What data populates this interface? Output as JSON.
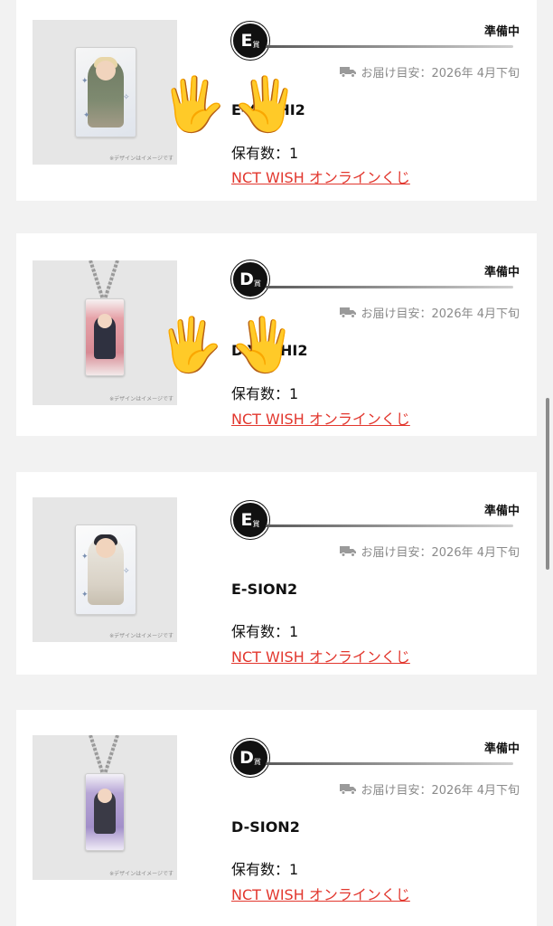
{
  "items": [
    {
      "rank_letter": "E",
      "rank_suffix": "賞",
      "status": "準備中",
      "delivery": "お届け目安：2026年 4月下旬",
      "name": "E-YUSHI2",
      "owned": "保有数：1",
      "link": "NCT WISH オンラインくじ",
      "thumb_note": "※デザインはイメージです",
      "thumb_icon": "acrylic-stand-icon"
    },
    {
      "rank_letter": "D",
      "rank_suffix": "賞",
      "status": "準備中",
      "delivery": "お届け目安：2026年 4月下旬",
      "name": "D-YUSHI2",
      "owned": "保有数：1",
      "link": "NCT WISH オンラインくじ",
      "thumb_note": "※デザインはイメージです",
      "thumb_icon": "keychain-icon"
    },
    {
      "rank_letter": "E",
      "rank_suffix": "賞",
      "status": "準備中",
      "delivery": "お届け目安：2026年 4月下旬",
      "name": "E-SION2",
      "owned": "保有数：1",
      "link": "NCT WISH オンラインくじ",
      "thumb_note": "※デザインはイメージです",
      "thumb_icon": "acrylic-stand-icon"
    },
    {
      "rank_letter": "D",
      "rank_suffix": "賞",
      "status": "準備中",
      "delivery": "お届け目安：2026年 4月下旬",
      "name": "D-SION2",
      "owned": "保有数：1",
      "link": "NCT WISH オンラインくじ",
      "thumb_note": "※デザインはイメージです",
      "thumb_icon": "keychain-icon"
    }
  ],
  "overlay": {
    "hand_emoji": "🖐",
    "hand_icon": "raised-hand-emoji-icon"
  },
  "colors": {
    "link": "#e2372e",
    "page_bg": "#f2f2f2",
    "card_bg": "#ffffff",
    "rank_badge": "#111111",
    "muted_text": "#8a8a8a"
  }
}
